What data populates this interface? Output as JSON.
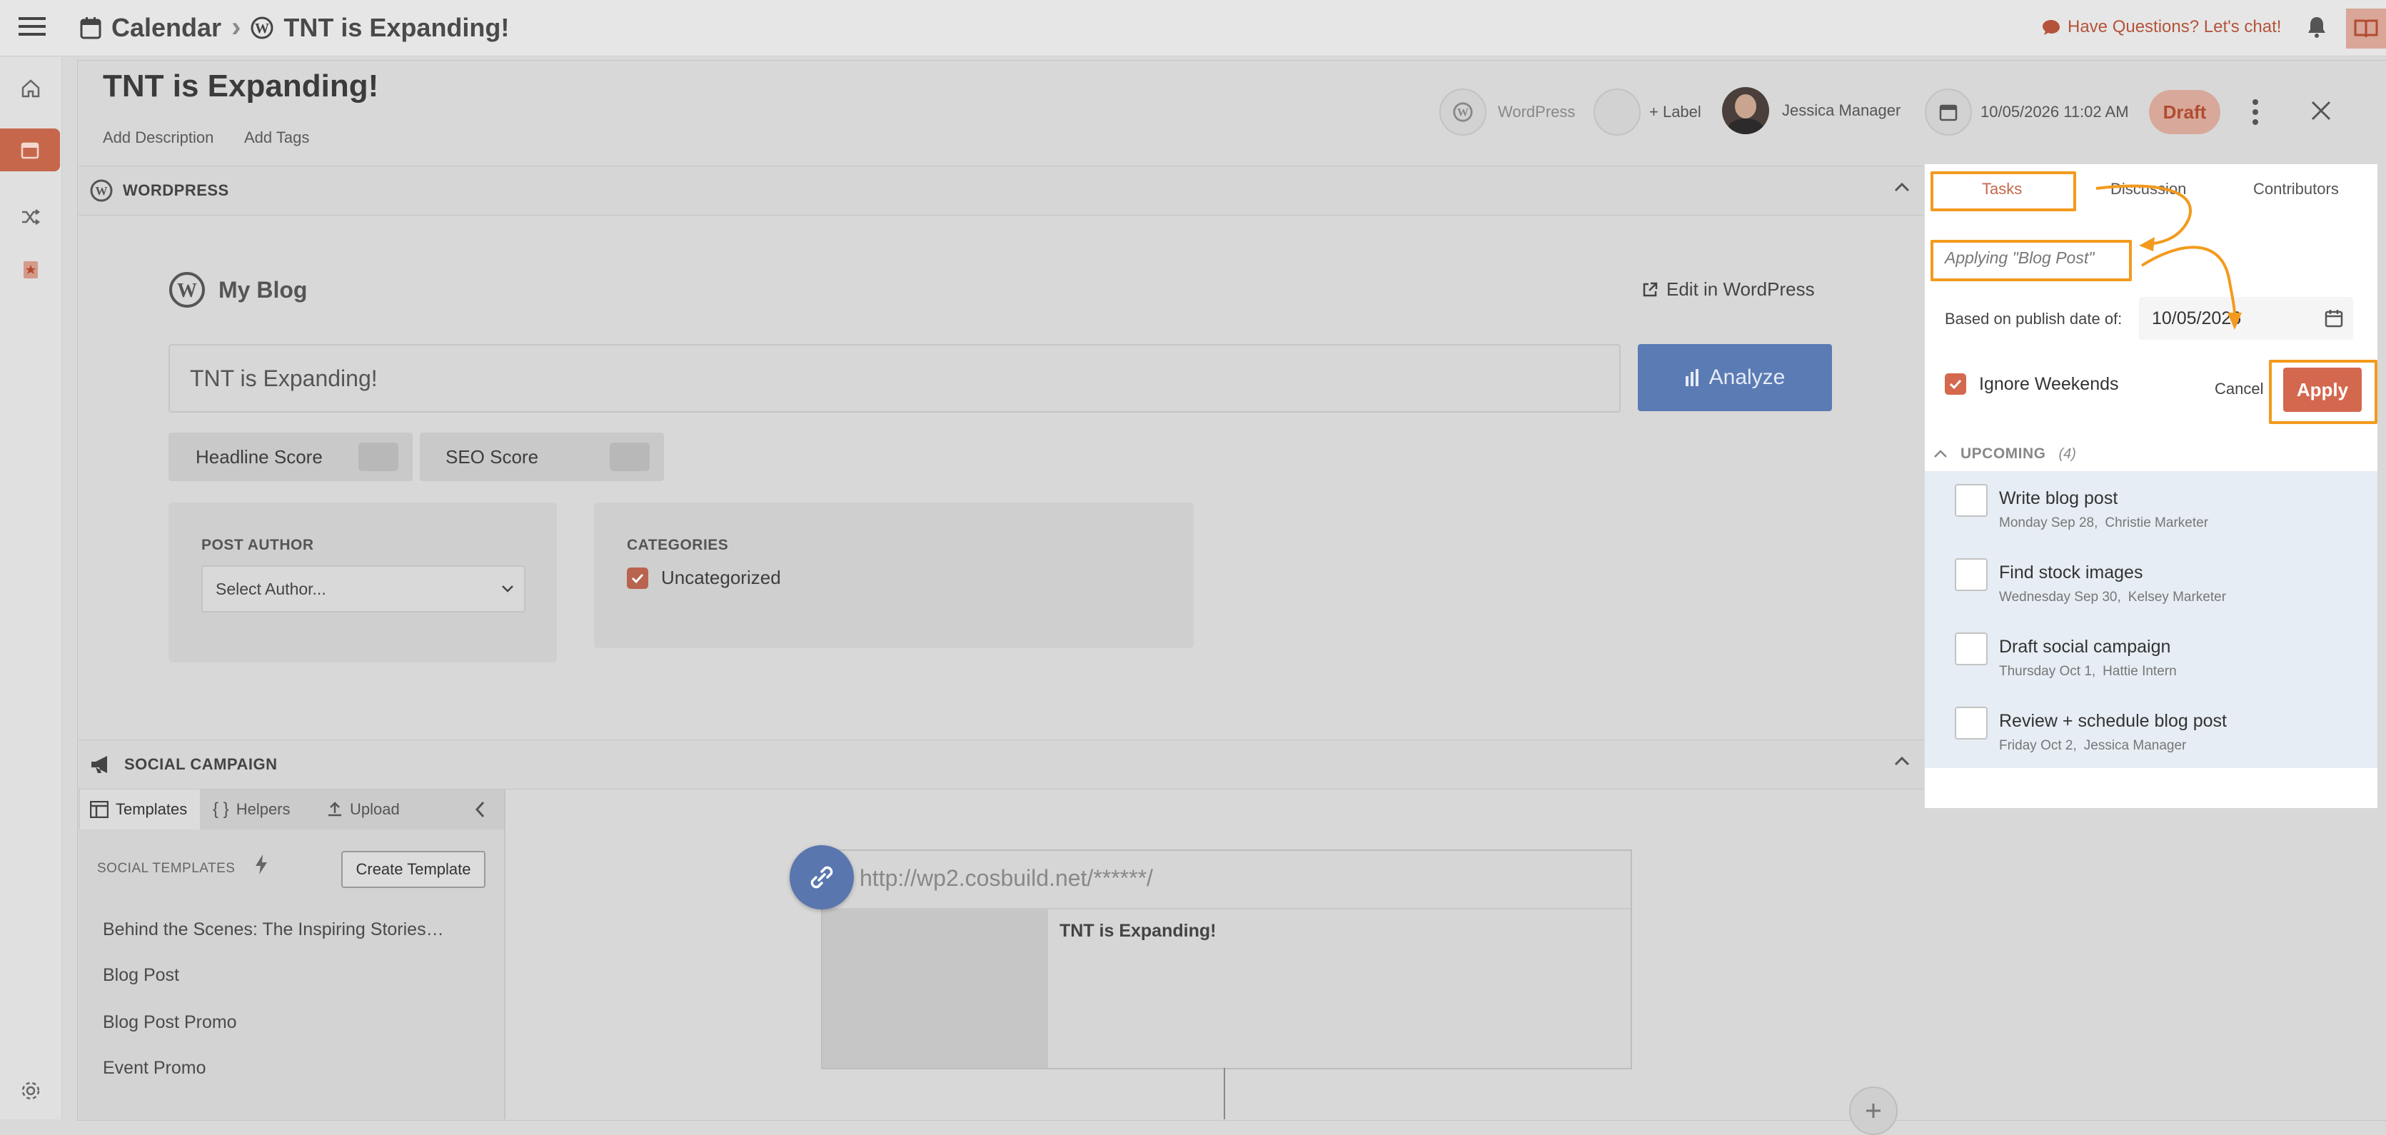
{
  "header": {
    "breadcrumb_root": "Calendar",
    "breadcrumb_separator": "›",
    "breadcrumb_current": "TNT is Expanding!",
    "chat_link": "Have Questions? Let's chat!"
  },
  "post": {
    "title": "TNT is Expanding!",
    "add_description": "Add Description",
    "add_tags": "Add Tags",
    "platform": "WordPress",
    "label_button": "+ Label",
    "owner": "Jessica Manager",
    "publish_datetime": "10/05/2026 11:02 AM",
    "status": "Draft"
  },
  "wordpress_section": {
    "title": "WORDPRESS",
    "blog_name": "My Blog",
    "edit_link": "Edit in WordPress",
    "title_value": "TNT is Expanding!",
    "analyze_button": "Analyze",
    "headline_score_label": "Headline Score",
    "seo_score_label": "SEO Score",
    "post_author_label": "POST AUTHOR",
    "author_select_value": "Select Author...",
    "categories_label": "CATEGORIES",
    "category_uncategorized": "Uncategorized"
  },
  "social_section": {
    "title": "SOCIAL CAMPAIGN",
    "tabs": [
      "Templates",
      "Helpers",
      "Upload"
    ],
    "templates_label": "SOCIAL TEMPLATES",
    "create_template_button": "Create Template",
    "templates": [
      "Behind the Scenes: The Inspiring Stories…",
      "Blog Post",
      "Blog Post Promo",
      "Event Promo"
    ],
    "preview_url": "http://wp2.cosbuild.net/******/",
    "preview_title": "TNT is Expanding!"
  },
  "right_panel": {
    "tabs": [
      "Tasks",
      "Discussion",
      "Contributors"
    ],
    "active_tab": "Tasks",
    "applying_text": "Applying \"Blog Post\"",
    "based_on_label": "Based on publish date of:",
    "date_value": "10/05/2026",
    "ignore_weekends_label": "Ignore Weekends",
    "ignore_weekends_checked": true,
    "cancel_button": "Cancel",
    "apply_button": "Apply",
    "upcoming_label": "UPCOMING",
    "upcoming_count": "(4)",
    "tasks": [
      {
        "title": "Write blog post",
        "date": "Monday Sep 28,",
        "assignee": "Christie Marketer"
      },
      {
        "title": "Find stock images",
        "date": "Wednesday Sep 30,",
        "assignee": "Kelsey Marketer"
      },
      {
        "title": "Draft social campaign",
        "date": "Thursday Oct 1,",
        "assignee": "Hattie Intern"
      },
      {
        "title": "Review + schedule blog post",
        "date": "Friday Oct 2,",
        "assignee": "Jessica Manager"
      }
    ]
  },
  "colors": {
    "brand": "#c6674b",
    "apply": "#d4684f",
    "analyze": "#5a7bb3",
    "highlight": "#f39a1d",
    "task_row_bg": "#e6edf4"
  }
}
